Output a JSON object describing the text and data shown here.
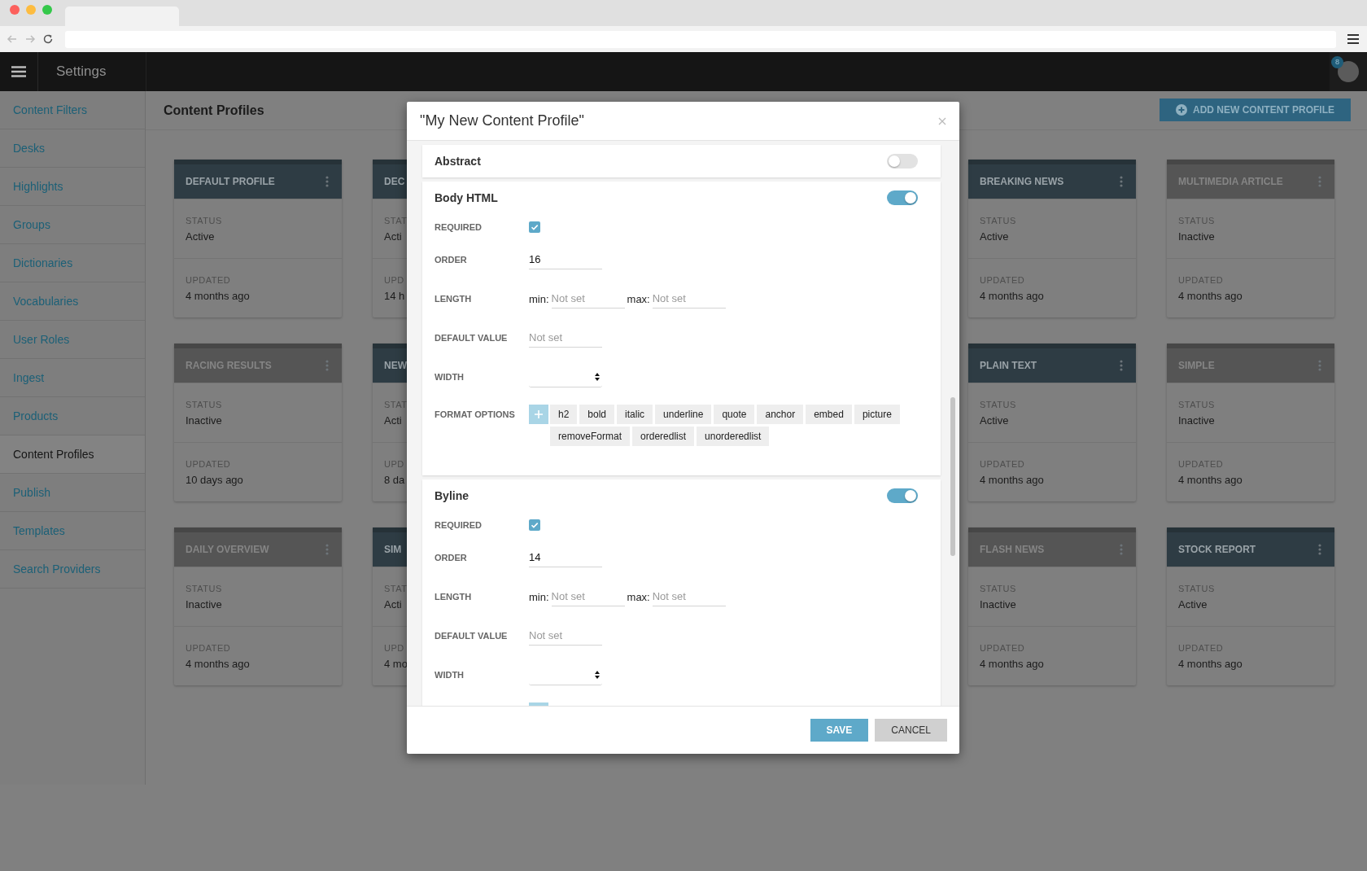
{
  "app_bar": {
    "title": "Settings",
    "notification_count": "8"
  },
  "sidebar": {
    "items": [
      {
        "label": "Content Filters",
        "selected": false
      },
      {
        "label": "Desks",
        "selected": false
      },
      {
        "label": "Highlights",
        "selected": false
      },
      {
        "label": "Groups",
        "selected": false
      },
      {
        "label": "Dictionaries",
        "selected": false
      },
      {
        "label": "Vocabularies",
        "selected": false
      },
      {
        "label": "User Roles",
        "selected": false
      },
      {
        "label": "Ingest",
        "selected": false
      },
      {
        "label": "Products",
        "selected": false
      },
      {
        "label": "Content Profiles",
        "selected": true
      },
      {
        "label": "Publish",
        "selected": false
      },
      {
        "label": "Templates",
        "selected": false
      },
      {
        "label": "Search Providers",
        "selected": false
      }
    ]
  },
  "page": {
    "title": "Content Profiles",
    "add_button": "ADD NEW CONTENT PROFILE"
  },
  "card_rows": [
    [
      {
        "title": "DEFAULT PROFILE",
        "active": true,
        "menu": true,
        "status_label": "STATUS",
        "status": "Active",
        "updated_label": "UPDATED",
        "updated": "4 months ago"
      },
      {
        "title": "DEC",
        "active": true,
        "menu": false,
        "status_label": "STAT",
        "status": "Acti",
        "updated_label": "UPD",
        "updated": "14 h"
      },
      {
        "title": "BREAKING NEWS",
        "active": true,
        "menu": true,
        "status_label": "STATUS",
        "status": "Active",
        "updated_label": "UPDATED",
        "updated": "4 months ago"
      },
      {
        "title": "MULTIMEDIA ARTICLE",
        "active": false,
        "menu": true,
        "status_label": "STATUS",
        "status": "Inactive",
        "updated_label": "UPDATED",
        "updated": "4 months ago"
      }
    ],
    [
      {
        "title": "RACING RESULTS",
        "active": false,
        "menu": true,
        "status_label": "STATUS",
        "status": "Inactive",
        "updated_label": "UPDATED",
        "updated": "10 days ago"
      },
      {
        "title": "NEW",
        "active": true,
        "menu": false,
        "status_label": "STAT",
        "status": "Acti",
        "updated_label": "UPD",
        "updated": "8 da"
      },
      {
        "title": "PLAIN TEXT",
        "active": true,
        "menu": true,
        "status_label": "STATUS",
        "status": "Active",
        "updated_label": "UPDATED",
        "updated": "4 months ago"
      },
      {
        "title": "SIMPLE",
        "active": false,
        "menu": true,
        "status_label": "STATUS",
        "status": "Inactive",
        "updated_label": "UPDATED",
        "updated": "4 months ago"
      }
    ],
    [
      {
        "title": "DAILY OVERVIEW",
        "active": false,
        "menu": true,
        "status_label": "STATUS",
        "status": "Inactive",
        "updated_label": "UPDATED",
        "updated": "4 months ago"
      },
      {
        "title": "SIM",
        "active": true,
        "menu": false,
        "status_label": "STAT",
        "status": "Acti",
        "updated_label": "UPD",
        "updated": "4 mo"
      },
      {
        "title": "FLASH NEWS",
        "active": false,
        "menu": true,
        "status_label": "STATUS",
        "status": "Inactive",
        "updated_label": "UPDATED",
        "updated": "4 months ago"
      },
      {
        "title": "STOCK REPORT",
        "active": true,
        "menu": true,
        "status_label": "STATUS",
        "status": "Active",
        "updated_label": "UPDATED",
        "updated": "4 months ago"
      }
    ]
  ],
  "dialog": {
    "title": "\"My New Content Profile\"",
    "sections": [
      {
        "name": "Abstract",
        "enabled": false
      },
      {
        "name": "Body HTML",
        "enabled": true,
        "fields": [
          {
            "kind": "checkbox",
            "label": "REQUIRED",
            "checked": true
          },
          {
            "kind": "input",
            "label": "ORDER",
            "value": "16"
          },
          {
            "kind": "range",
            "label": "LENGTH",
            "min_label": "min:",
            "min_placeholder": "Not set",
            "max_label": "max:",
            "max_placeholder": "Not set"
          },
          {
            "kind": "input",
            "label": "DEFAULT VALUE",
            "placeholder": "Not set"
          },
          {
            "kind": "select",
            "label": "WIDTH"
          },
          {
            "kind": "tags",
            "label": "FORMAT OPTIONS",
            "tags": [
              "h2",
              "bold",
              "italic",
              "underline",
              "quote",
              "anchor",
              "embed",
              "picture",
              "removeFormat",
              "orderedlist",
              "unorderedlist"
            ]
          }
        ]
      },
      {
        "name": "Byline",
        "enabled": true,
        "fields": [
          {
            "kind": "checkbox",
            "label": "REQUIRED",
            "checked": true
          },
          {
            "kind": "input",
            "label": "ORDER",
            "value": "14"
          },
          {
            "kind": "range",
            "label": "LENGTH",
            "min_label": "min:",
            "min_placeholder": "Not set",
            "max_label": "max:",
            "max_placeholder": "Not set"
          },
          {
            "kind": "input",
            "label": "DEFAULT VALUE",
            "placeholder": "Not set"
          },
          {
            "kind": "select",
            "label": "WIDTH"
          },
          {
            "kind": "tags"
          }
        ]
      }
    ],
    "buttons": [
      {
        "label": "SAVE",
        "kind": "primary"
      },
      {
        "label": "CANCEL",
        "kind": "secondary"
      }
    ]
  }
}
